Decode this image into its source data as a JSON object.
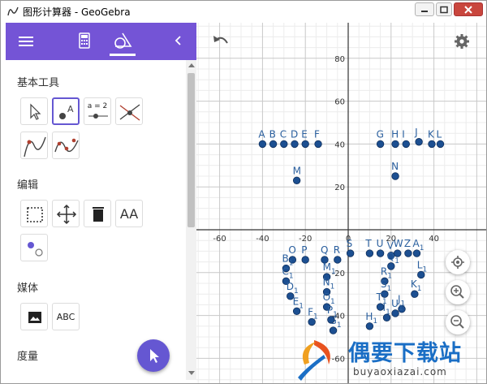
{
  "window": {
    "title": "图形计算器 - GeoGebra"
  },
  "sidebar": {
    "sections": [
      {
        "title": "基本工具"
      },
      {
        "title": "编辑"
      },
      {
        "title": "媒体"
      },
      {
        "title": "度量"
      }
    ],
    "tool_text": {
      "slider": "a = 2",
      "text_tool": "ABC",
      "style": "AA"
    }
  },
  "axes": {
    "x_ticks": [
      "-60",
      "-40",
      "-20",
      "0",
      "20",
      "40"
    ],
    "y_ticks": [
      "80",
      "60",
      "40",
      "20",
      "-20",
      "-40",
      "-60"
    ]
  },
  "points": [
    {
      "label": "A",
      "x": -40,
      "y": 40
    },
    {
      "label": "B",
      "x": -35,
      "y": 40
    },
    {
      "label": "C",
      "x": -30,
      "y": 40
    },
    {
      "label": "D",
      "x": -25,
      "y": 40
    },
    {
      "label": "E",
      "x": -20,
      "y": 40
    },
    {
      "label": "F",
      "x": -14,
      "y": 40
    },
    {
      "label": "M",
      "x": -24,
      "y": 23
    },
    {
      "label": "G",
      "x": 15,
      "y": 40
    },
    {
      "label": "H",
      "x": 22,
      "y": 40
    },
    {
      "label": "I",
      "x": 27,
      "y": 40
    },
    {
      "label": "J",
      "x": 33,
      "y": 41
    },
    {
      "label": "K",
      "x": 39,
      "y": 40
    },
    {
      "label": "L",
      "x": 43,
      "y": 40
    },
    {
      "label": "N",
      "x": 22,
      "y": 25
    },
    {
      "label": "O",
      "x": -26,
      "y": -14
    },
    {
      "label": "P",
      "x": -20,
      "y": -14
    },
    {
      "label": "Q",
      "x": -11,
      "y": -14
    },
    {
      "label": "R",
      "x": -5,
      "y": -14
    },
    {
      "label": "S",
      "x": 1,
      "y": -11
    },
    {
      "label": "T",
      "x": 10,
      "y": -11
    },
    {
      "label": "U",
      "x": 15,
      "y": -11
    },
    {
      "label": "V",
      "x": 20,
      "y": -12
    },
    {
      "label": "W",
      "x": 23,
      "y": -11
    },
    {
      "label": "Z",
      "x": 28,
      "y": -11
    },
    {
      "label": "A1",
      "x": 32,
      "y": -11
    },
    {
      "label": "B1",
      "x": -29,
      "y": -18
    },
    {
      "label": "C1",
      "x": -29,
      "y": -24
    },
    {
      "label": "D1",
      "x": -27,
      "y": -31
    },
    {
      "label": "E1",
      "x": -24,
      "y": -38
    },
    {
      "label": "F1",
      "x": -17,
      "y": -43
    },
    {
      "label": "G1",
      "x": -7,
      "y": -47
    },
    {
      "label": "H1",
      "x": 10,
      "y": -45
    },
    {
      "label": "I1",
      "x": 18,
      "y": -41
    },
    {
      "label": "J1",
      "x": 25,
      "y": -37
    },
    {
      "label": "K1",
      "x": 31,
      "y": -30
    },
    {
      "label": "L1",
      "x": 34,
      "y": -21
    },
    {
      "label": "M1",
      "x": -10,
      "y": -22
    },
    {
      "label": "N1",
      "x": -10,
      "y": -29
    },
    {
      "label": "O1",
      "x": -10,
      "y": -36
    },
    {
      "label": "P1",
      "x": -8,
      "y": -42
    },
    {
      "label": "Q1",
      "x": 20,
      "y": -17
    },
    {
      "label": "R1",
      "x": 17,
      "y": -24
    },
    {
      "label": "S1",
      "x": 17,
      "y": -30
    },
    {
      "label": "T1",
      "x": 15,
      "y": -36
    },
    {
      "label": "U1",
      "x": 22,
      "y": -39
    }
  ],
  "watermark": {
    "main": "偶要下载站",
    "sub": "buyaoxiazai.com"
  }
}
